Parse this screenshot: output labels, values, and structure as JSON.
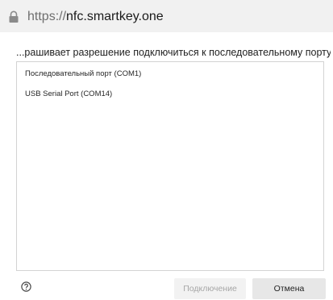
{
  "url_bar": {
    "icon": "lock-icon",
    "scheme": "https://",
    "host": "nfc.smartkey.one"
  },
  "prompt_text": "...рашивает разрешение подключиться к последовательному порту",
  "ports": [
    {
      "label": "Последовательный порт (COM1)"
    },
    {
      "label": "USB Serial Port (COM14)"
    }
  ],
  "footer": {
    "help_icon": "help-circle-icon",
    "connect_label": "Подключение",
    "connect_enabled": false,
    "cancel_label": "Отмена"
  }
}
